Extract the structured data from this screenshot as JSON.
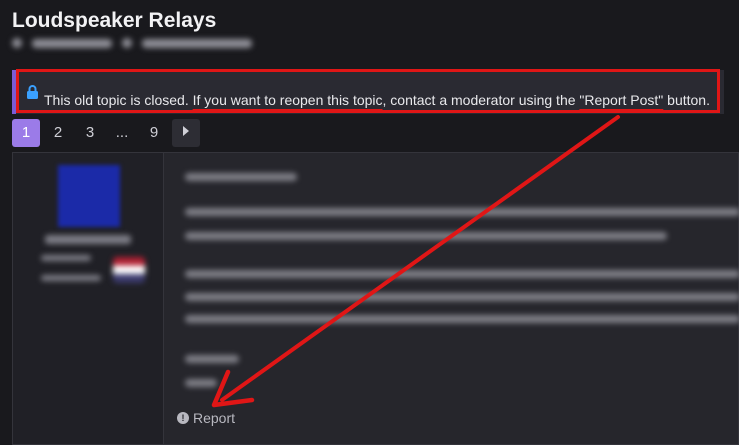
{
  "page": {
    "title": "Loudspeaker Relays"
  },
  "notice": {
    "prefix": "This old topic is closed. ",
    "underlined_1": "If you want to reopen this topic",
    "middle": ", contact a moderator using the ",
    "underlined_2": "\"Report Post\"",
    "suffix": " button."
  },
  "pagination": {
    "pages": [
      "1",
      "2",
      "3",
      "...",
      "9"
    ],
    "active": "1",
    "next_icon": "chevron-right-icon"
  },
  "post": {
    "report_label": "Report",
    "report_icon": "exclamation-icon"
  },
  "colors": {
    "accent": "#9b7be8",
    "annotation": "#e01616",
    "notice_border": "#7b5bd6",
    "lock": "#3aa0ff"
  }
}
